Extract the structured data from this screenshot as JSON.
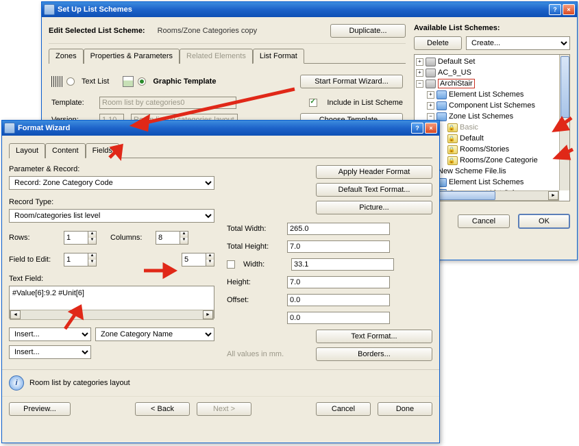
{
  "setup": {
    "title": "Set Up List Schemes",
    "edit_label": "Edit Selected List Scheme:",
    "edit_value": "Rooms/Zone Categories copy",
    "duplicate": "Duplicate...",
    "available_label": "Available List Schemes:",
    "delete": "Delete",
    "create": "Create...",
    "tabs": {
      "zones": "Zones",
      "props": "Properties & Parameters",
      "related": "Related Elements",
      "format": "List Format"
    },
    "text_list": "Text List",
    "graphic_template": "Graphic Template",
    "start_wizard": "Start Format Wizard...",
    "template_lbl": "Template:",
    "template_val": "Room list by categories0",
    "version_lbl": "Version:",
    "version_val": "1.10",
    "version_desc": "Room list by categories layout",
    "include": "Include in List Scheme",
    "choose_template": "Choose Template...",
    "cancel": "Cancel",
    "ok": "OK",
    "tree": {
      "n0": "Default Set",
      "n1": "AC_9_US",
      "n2": "ArchiStair",
      "n3": "Element List Schemes",
      "n4": "Component List Schemes",
      "n5": "Zone List Schemes",
      "n6": "Basic",
      "n7": "Default",
      "n8": "Rooms/Stories",
      "n9": "Rooms/Zone Categorie",
      "n10": "New Scheme File.lis",
      "n11": "Element List Schemes",
      "n12": "Component List Schemes"
    }
  },
  "wizard": {
    "title": "Format Wizard",
    "tabs": {
      "layout": "Layout",
      "content": "Content",
      "fields": "Fields"
    },
    "param_record": "Parameter & Record:",
    "record_sel": "Record: Zone Category Code",
    "apply_header": "Apply Header Format",
    "default_text": "Default Text Format...",
    "picture": "Picture...",
    "record_type_lbl": "Record Type:",
    "record_type_val": "Room/categories list level",
    "rows_lbl": "Rows:",
    "rows_val": "1",
    "cols_lbl": "Columns:",
    "cols_val": "8",
    "field_edit_lbl": "Field to Edit:",
    "field_edit_val": "1",
    "second_spin": "5",
    "width_lbl": "Width:",
    "total_width_lbl": "Total Width:",
    "total_width_val": "265.0",
    "total_height_lbl": "Total Height:",
    "total_height_val": "7.0",
    "width_val": "33.1",
    "height_lbl": "Height:",
    "height_val": "7.0",
    "offset_lbl": "Offset:",
    "offset_val": "0.0",
    "offset2_val": "0.0",
    "text_field_lbl": "Text Field:",
    "text_field_val": "#Value[6]:9.2 #Unit[6]",
    "insert1": "Insert...",
    "zone_cat": "Zone Category Name",
    "insert2": "Insert...",
    "all_values": "All values in mm.",
    "text_format": "Text Format...",
    "borders": "Borders...",
    "footer_note": "Room list by categories layout",
    "preview": "Preview...",
    "back": "< Back",
    "next": "Next >",
    "cancel": "Cancel",
    "done": "Done"
  }
}
